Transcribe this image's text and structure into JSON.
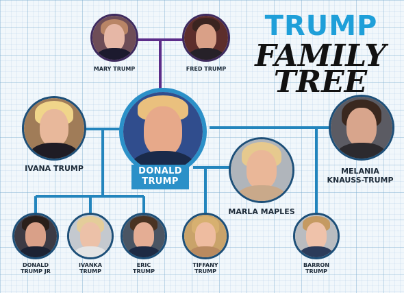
{
  "title": {
    "line1": "TRUMP",
    "line2": "FAMILY",
    "line3": "TREE"
  },
  "colors": {
    "line_parents": "#5c2d8a",
    "line_children": "#2385bd",
    "accent": "#2b90c8",
    "title_blue": "#1e9fd9"
  },
  "people": {
    "mary": "MARY TRUMP",
    "fred": "FRED TRUMP",
    "donald_line1": "DONALD",
    "donald_line2": "TRUMP",
    "ivana": "IVANA TRUMP",
    "marla": "MARLA MAPLES",
    "melania_line1": "MELANIA",
    "melania_line2": "KNAUSS-TRUMP",
    "donald_jr_line1": "DONALD",
    "donald_jr_line2": "TRUMP JR",
    "ivanka_line1": "IVANKA",
    "ivanka_line2": "TRUMP",
    "eric_line1": "ERIC",
    "eric_line2": "TRUMP",
    "tiffany_line1": "TIFFANY",
    "tiffany_line2": "TRUMP",
    "barron_line1": "BARRON",
    "barron_line2": "TRUMP"
  }
}
